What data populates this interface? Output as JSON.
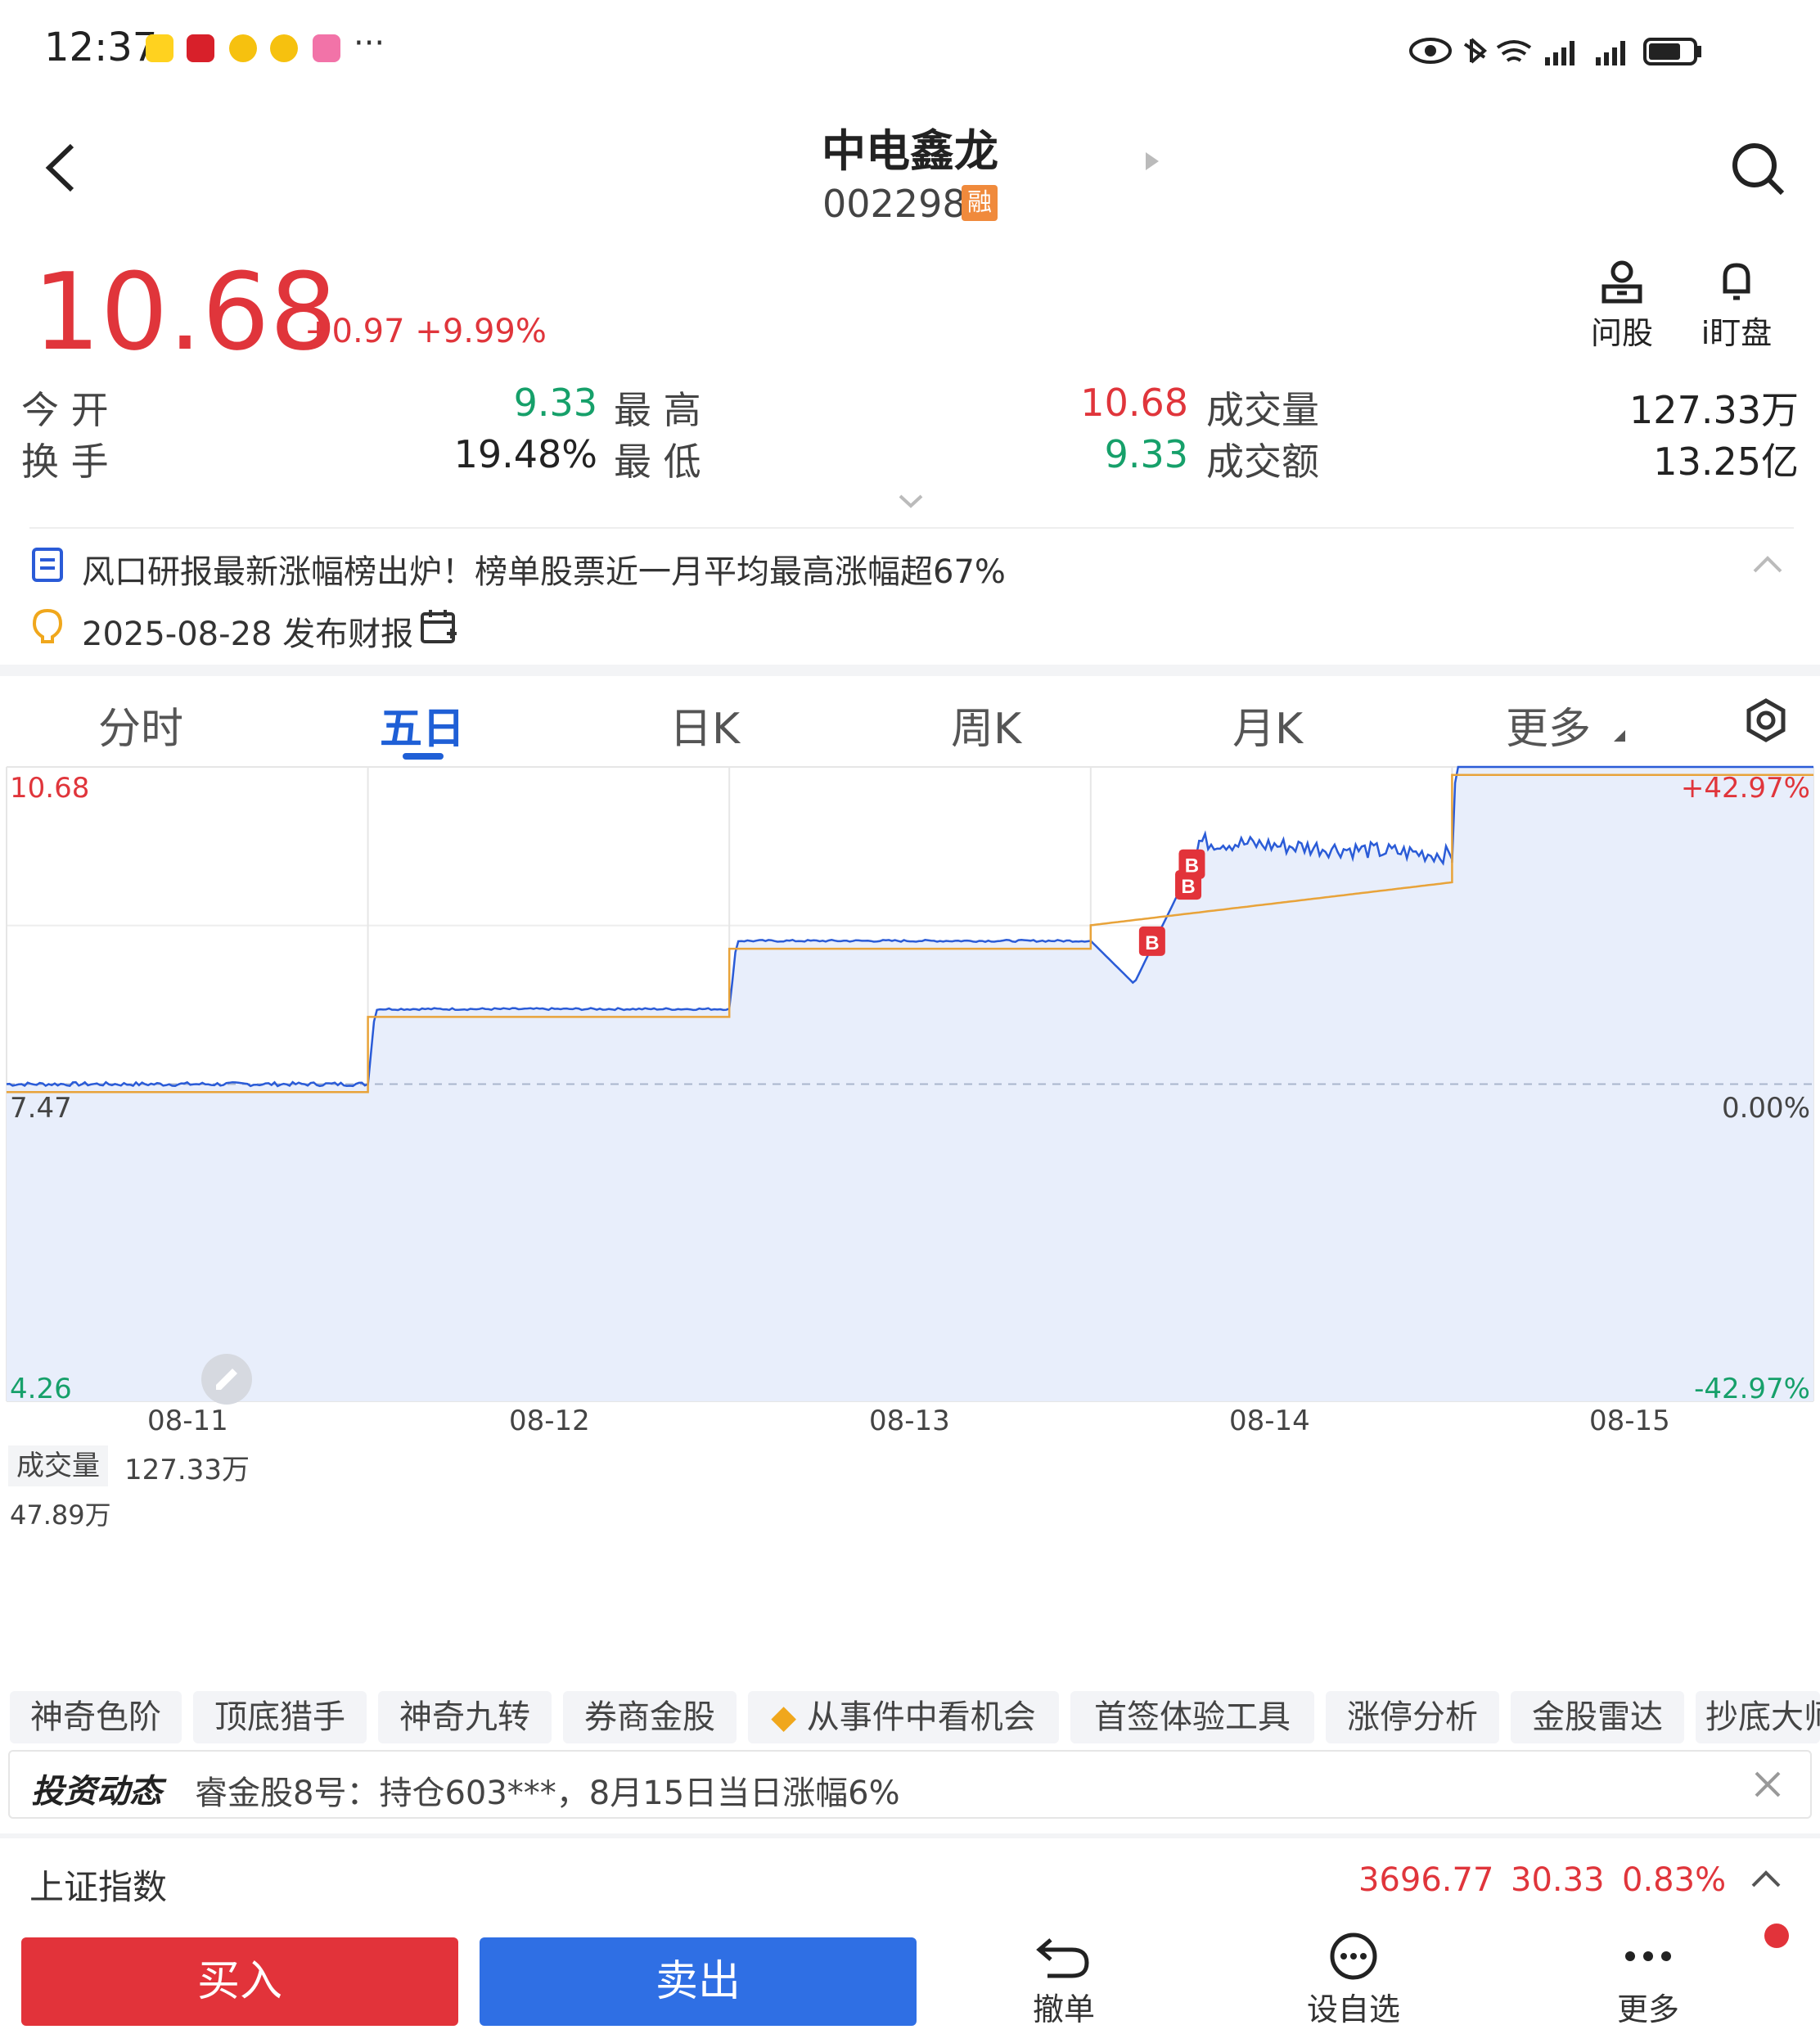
{
  "status_bar": {
    "time": "12:37",
    "more": "···"
  },
  "header": {
    "title": "中电鑫龙",
    "code": "002298",
    "badge": "融"
  },
  "quote": {
    "price": "10.68",
    "change": "+0.97",
    "change_pct": "+9.99%",
    "actions": [
      {
        "label": "问股",
        "icon": "person-icon"
      },
      {
        "label": "i盯盘",
        "icon": "bell-icon"
      }
    ],
    "rows": [
      {
        "l1": "今 开",
        "v1": "9.33",
        "l2": "最 高",
        "v2": "10.68",
        "l3": "成交量",
        "v3": "127.33万"
      },
      {
        "l1": "换 手",
        "v1": "19.48%",
        "l2": "最 低",
        "v2": "9.33",
        "l3": "成交额",
        "v3": "13.25亿"
      }
    ]
  },
  "news": {
    "headline": "风口研报最新涨幅榜出炉！榜单股票近一月平均最高涨幅超67%",
    "report": "2025-08-28 发布财报"
  },
  "tabs": [
    "分时",
    "五日",
    "日K",
    "周K",
    "月K",
    "更多"
  ],
  "active_tab": "五日",
  "chart": {
    "price_labels": {
      "top": "10.68",
      "mid": "7.47",
      "bottom": "4.26"
    },
    "pct_labels": {
      "top": "+42.97%",
      "mid": "0.00%",
      "bottom": "-42.97%"
    },
    "dates": [
      "08-11",
      "08-12",
      "08-13",
      "08-14",
      "08-15"
    ],
    "volume_label": "成交量",
    "volume_value": "127.33万",
    "volume_max": "47.89万",
    "marker_label": "B"
  },
  "chart_data": {
    "type": "line",
    "title": "",
    "x": [
      "08-11",
      "08-12",
      "08-13",
      "08-14",
      "08-15"
    ],
    "ylim": [
      4.26,
      10.68
    ],
    "series": [
      {
        "values": [
          7.47,
          8.23,
          8.92,
          9.71,
          10.68
        ]
      }
    ],
    "volume": {
      "max": "47.89万",
      "total": "127.33万"
    },
    "colors": {
      "line": "#2a5bd7",
      "avg": "#e8a33a",
      "fill": "#e8eefb"
    }
  },
  "feature_chips": [
    "神奇色阶",
    "顶底猎手",
    "神奇九转",
    "券商金股",
    "从事件中看机会",
    "首签体验工具",
    "涨停分析",
    "金股雷达",
    "抄底大师"
  ],
  "invest": {
    "tag": "投资动态",
    "text": "睿金股8号：持仓603***，8月15日当日涨幅6%"
  },
  "index": {
    "name": "上证指数",
    "value": "3696.77",
    "change": "30.33",
    "pct": "0.83%"
  },
  "bottom": {
    "buy": "买入",
    "sell": "卖出",
    "cancel": "撤单",
    "watch": "设自选",
    "more": "更多"
  }
}
